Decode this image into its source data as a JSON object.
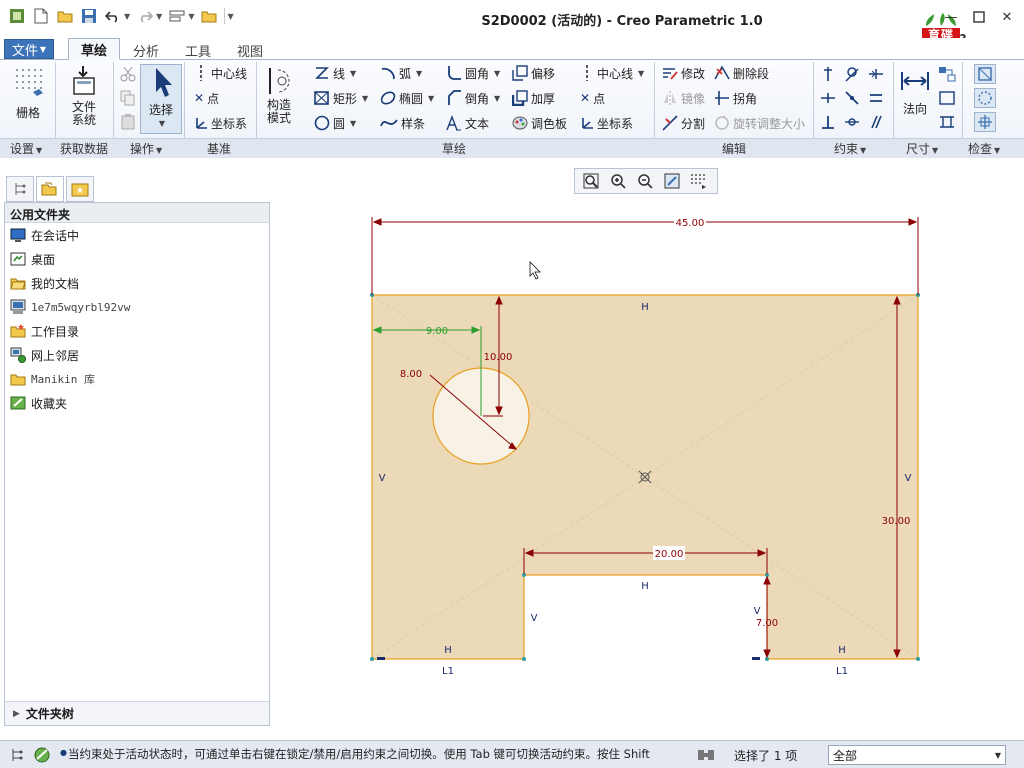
{
  "window": {
    "title": "S2D0002 (活动的) - Creo Parametric 1.0"
  },
  "logo": {
    "text_top": "育碟",
    "text_bottom": "软件"
  },
  "menu_tabs": [
    "文件",
    "草绘",
    "分析",
    "工具",
    "视图"
  ],
  "ribbon": {
    "grid": "栅格",
    "file_system": [
      "文件",
      "系统"
    ],
    "select": "选择",
    "datum": {
      "centerline": "中心线",
      "point": "点",
      "csys": "坐标系"
    },
    "construct_mode": [
      "构造",
      "模式"
    ],
    "sketch": {
      "line": "线",
      "arc": "弧",
      "fillet": "圆角",
      "offset": "偏移",
      "rectangle": "矩形",
      "ellipse": "椭圆",
      "chamfer": "倒角",
      "thicken": "加厚",
      "circle": "圆",
      "spline": "样条",
      "text": "文本",
      "palette": "调色板",
      "centerline": "中心线",
      "point": "点",
      "csys": "坐标系"
    },
    "edit": {
      "modify": "修改",
      "delete_segment": "删除段",
      "mirror": "镜像",
      "corner": "拐角",
      "divide": "分割",
      "rotate_resize": "旋转调整大小"
    },
    "dimension": {
      "normal": "法向"
    },
    "groups": {
      "settings": "设置",
      "get_data": "获取数据",
      "operations": "操作",
      "datum": "基准",
      "sketch": "草绘",
      "edit": "编辑",
      "constrain": "约束",
      "dimension": "尺寸",
      "inspect": "检查"
    }
  },
  "navigator": {
    "header": "公用文件夹",
    "items": [
      {
        "label": "在会话中",
        "icon": "monitor-icon"
      },
      {
        "label": "桌面",
        "icon": "desktop-icon"
      },
      {
        "label": "我的文档",
        "icon": "folder-open-icon"
      },
      {
        "label": "1e7m5wqyrbl92vw",
        "icon": "computer-icon"
      },
      {
        "label": "工作目录",
        "icon": "folder-star-icon"
      },
      {
        "label": "网上邻居",
        "icon": "network-icon"
      },
      {
        "label": "Manikin 库",
        "icon": "folder-icon"
      },
      {
        "label": "收藏夹",
        "icon": "favorites-icon"
      }
    ],
    "footer": "文件夹树"
  },
  "sketch": {
    "dims": {
      "width": "45.00",
      "height": "30.00",
      "hole_x": "9.00",
      "hole_y": "10.00",
      "hole_d": "8.00",
      "slot_w": "20.00",
      "slot_d": "7.00"
    },
    "constraints": {
      "horizontal": "H",
      "vertical": "V",
      "equal": "L1"
    },
    "colors": {
      "fill": "#ecd9b8",
      "edge": "#e8a020",
      "dimension": "#8b0000",
      "weak_dimension": "#2ca02c"
    }
  },
  "status": {
    "message": "当约束处于活动状态时，可通过单击右键在锁定/禁用/启用约束之间切换。使用 Tab 键可切换活动约束。按住 Shift",
    "selected": "选择了 1 项",
    "filter": "全部"
  }
}
